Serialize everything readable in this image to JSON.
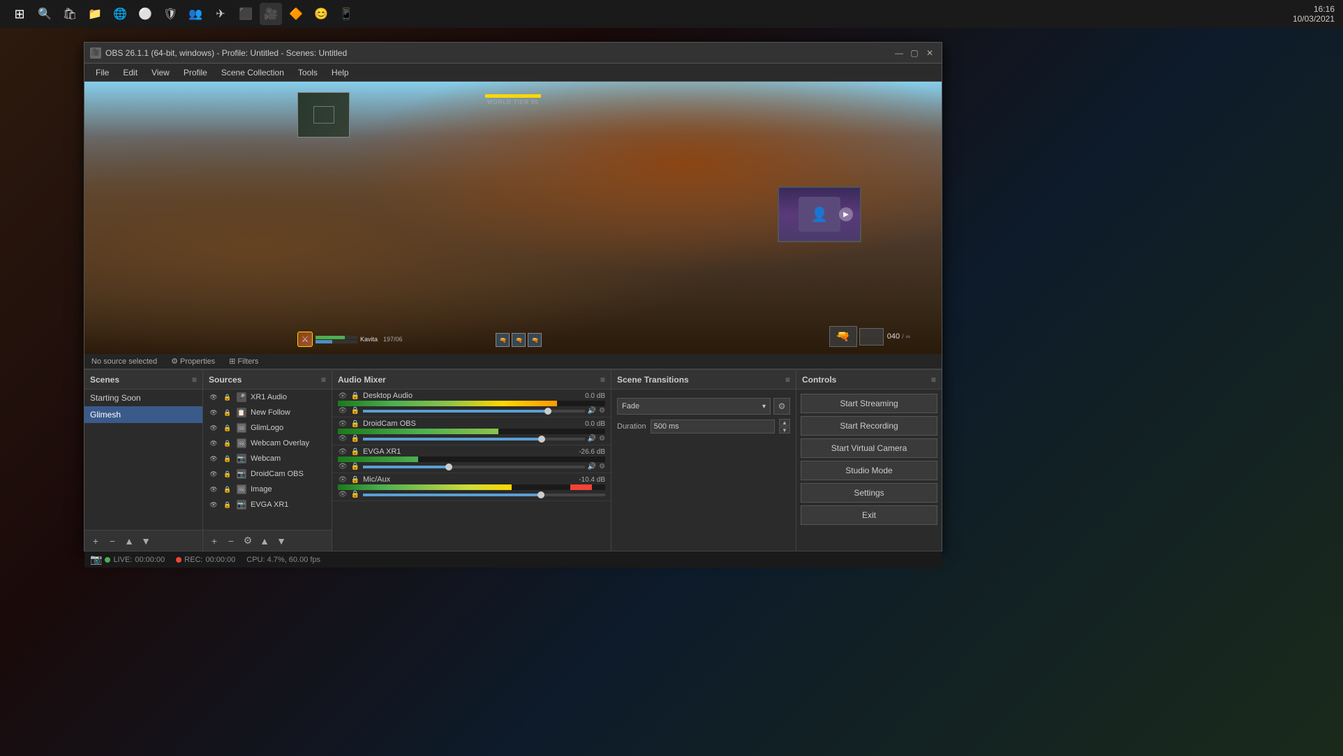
{
  "taskbar": {
    "time": "16:16",
    "date": "10/03/2021",
    "start_label": "⊞"
  },
  "window": {
    "title": "OBS 26.1.1 (64-bit, windows) - Profile: Untitled - Scenes: Untitled",
    "icon": "⬜"
  },
  "menu": {
    "items": [
      "File",
      "Edit",
      "View",
      "Profile",
      "Scene Collection",
      "Tools",
      "Help"
    ]
  },
  "preview": {
    "hud_label": "WORLD TIER 05",
    "player_name": "Kavita",
    "ammo": "197/06",
    "ammo_counter": "040"
  },
  "no_source_bar": {
    "text": "No source selected",
    "properties": "Properties",
    "filters": "Filters"
  },
  "scenes": {
    "title": "Scenes",
    "items": [
      {
        "label": "Starting Soon",
        "active": false
      },
      {
        "label": "Glimesh",
        "active": true
      }
    ],
    "footer_buttons": [
      "+",
      "-",
      "▲",
      "▼"
    ]
  },
  "sources": {
    "title": "Sources",
    "items": [
      {
        "label": "XR1 Audio",
        "icon": "🎤",
        "type": "audio"
      },
      {
        "label": "New Follow",
        "icon": "📋",
        "type": "text"
      },
      {
        "label": "GlimLogo",
        "icon": "🖼",
        "type": "image"
      },
      {
        "label": "Webcam Overlay",
        "icon": "🖼",
        "type": "image"
      },
      {
        "label": "Webcam",
        "icon": "📷",
        "type": "video"
      },
      {
        "label": "DroidCam OBS",
        "icon": "📷",
        "type": "video"
      },
      {
        "label": "Image",
        "icon": "🖼",
        "type": "image"
      },
      {
        "label": "EVGA XR1",
        "icon": "📷",
        "type": "video"
      }
    ],
    "footer_buttons": [
      "+",
      "-",
      "⚙",
      "▲",
      "▼"
    ]
  },
  "audio_mixer": {
    "title": "Audio Mixer",
    "items": [
      {
        "name": "Desktop Audio",
        "db": "0.0 dB",
        "vol_pct": 85,
        "muted": false
      },
      {
        "name": "DroidCam OBS",
        "db": "0.0 dB",
        "vol_pct": 82,
        "muted": false
      },
      {
        "name": "EVGA XR1",
        "db": "-26.6 dB",
        "vol_pct": 40,
        "muted": false
      },
      {
        "name": "Mic/Aux",
        "db": "-10.4 dB",
        "vol_pct": 75,
        "muted": false
      }
    ]
  },
  "scene_transitions": {
    "title": "Scene Transitions",
    "selected": "Fade",
    "duration_label": "Duration",
    "duration_value": "500 ms"
  },
  "controls": {
    "title": "Controls",
    "buttons": [
      {
        "label": "Start Streaming",
        "id": "start-streaming"
      },
      {
        "label": "Start Recording",
        "id": "start-recording"
      },
      {
        "label": "Start Virtual Camera",
        "id": "start-virtual-camera"
      },
      {
        "label": "Studio Mode",
        "id": "studio-mode"
      },
      {
        "label": "Settings",
        "id": "settings"
      },
      {
        "label": "Exit",
        "id": "exit"
      }
    ]
  },
  "status_bar": {
    "live_label": "LIVE:",
    "live_time": "00:00:00",
    "rec_label": "REC:",
    "rec_time": "00:00:00",
    "cpu_label": "CPU: 4.7%, 60.00 fps"
  }
}
